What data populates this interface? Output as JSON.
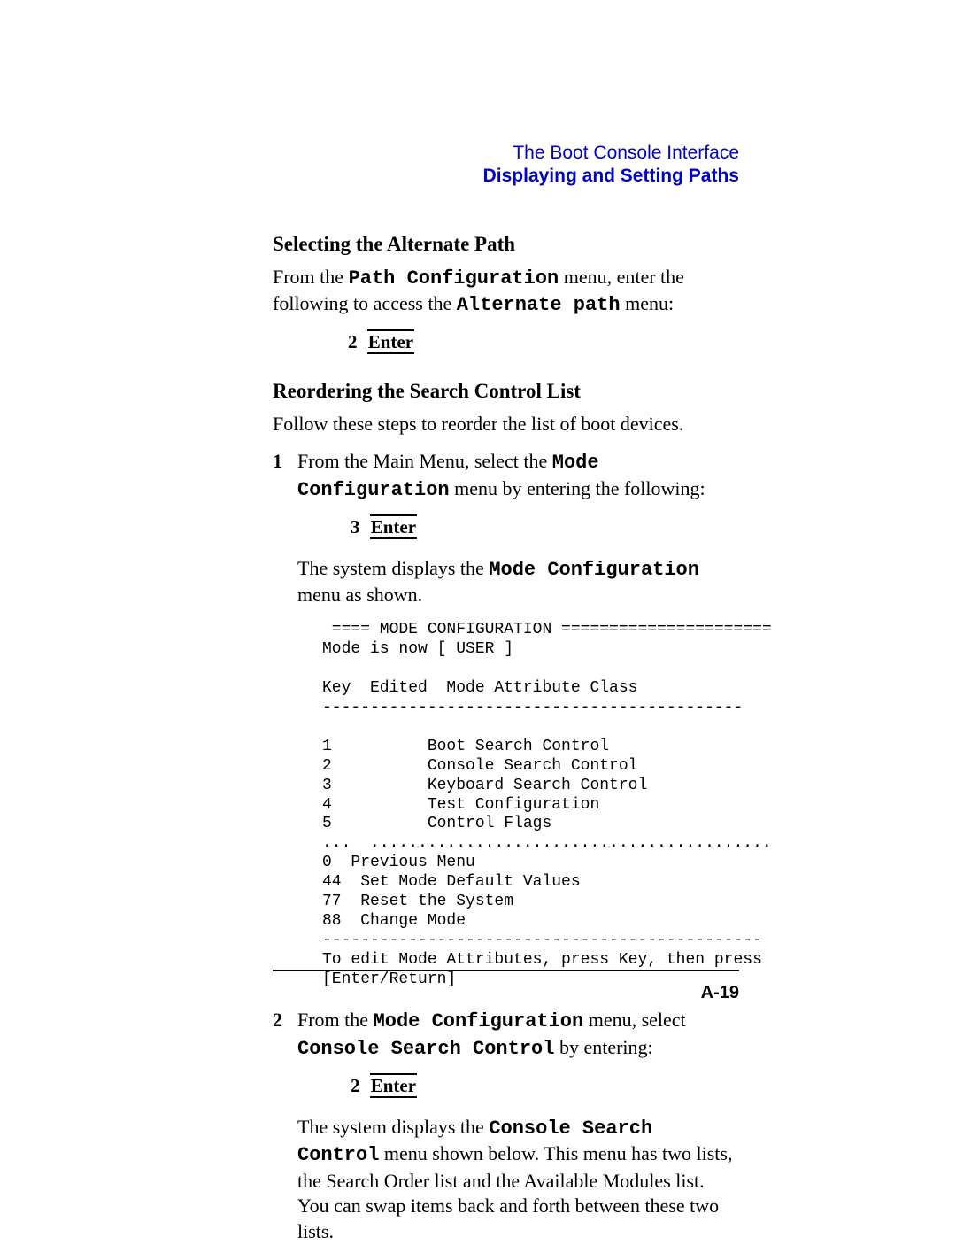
{
  "header": {
    "chapter": "The Boot Console Interface",
    "section": "Displaying and Setting Paths"
  },
  "sec1": {
    "title": "Selecting the Alternate Path",
    "intro_pre": "From the ",
    "intro_mono1": "Path Configuration",
    "intro_mid": " menu, enter the following to access the ",
    "intro_mono2": "Alternate path",
    "intro_post": " menu:",
    "kbd_num": "2",
    "kbd_key": "Enter"
  },
  "sec2": {
    "title": "Reordering the Search Control List",
    "intro": "Follow these steps to reorder the list of boot devices.",
    "steps": {
      "s1": {
        "t_pre": "From the Main Menu, select the ",
        "t_mono": "Mode Configuration",
        "t_post": " menu by entering the following:",
        "kbd_num": "3",
        "kbd_key": "Enter",
        "after_pre": "The system displays the ",
        "after_mono": "Mode Configuration",
        "after_post": " menu as shown.",
        "console": " ==== MODE CONFIGURATION ======================\nMode is now [ USER ]\n\nKey  Edited  Mode Attribute Class\n--------------------------------------------\n\n1          Boot Search Control\n2          Console Search Control\n3          Keyboard Search Control\n4          Test Configuration\n5          Control Flags\n...  ..........................................\n0  Previous Menu\n44  Set Mode Default Values\n77  Reset the System\n88  Change Mode\n----------------------------------------------\nTo edit Mode Attributes, press Key, then press\n[Enter/Return]"
      },
      "s2": {
        "t_pre": "From the ",
        "t_mono1": "Mode Configuration",
        "t_mid": " menu, select ",
        "t_mono2": "Console Search Control",
        "t_post": " by entering:",
        "kbd_num": "2",
        "kbd_key": "Enter",
        "after_pre": "The system displays the ",
        "after_mono": "Console Search Control",
        "after_post": " menu shown below. This menu has two lists, the Search Order list and the Available Modules list. You can swap items back and forth between these two lists."
      }
    }
  },
  "footer": {
    "page": "A-19"
  }
}
